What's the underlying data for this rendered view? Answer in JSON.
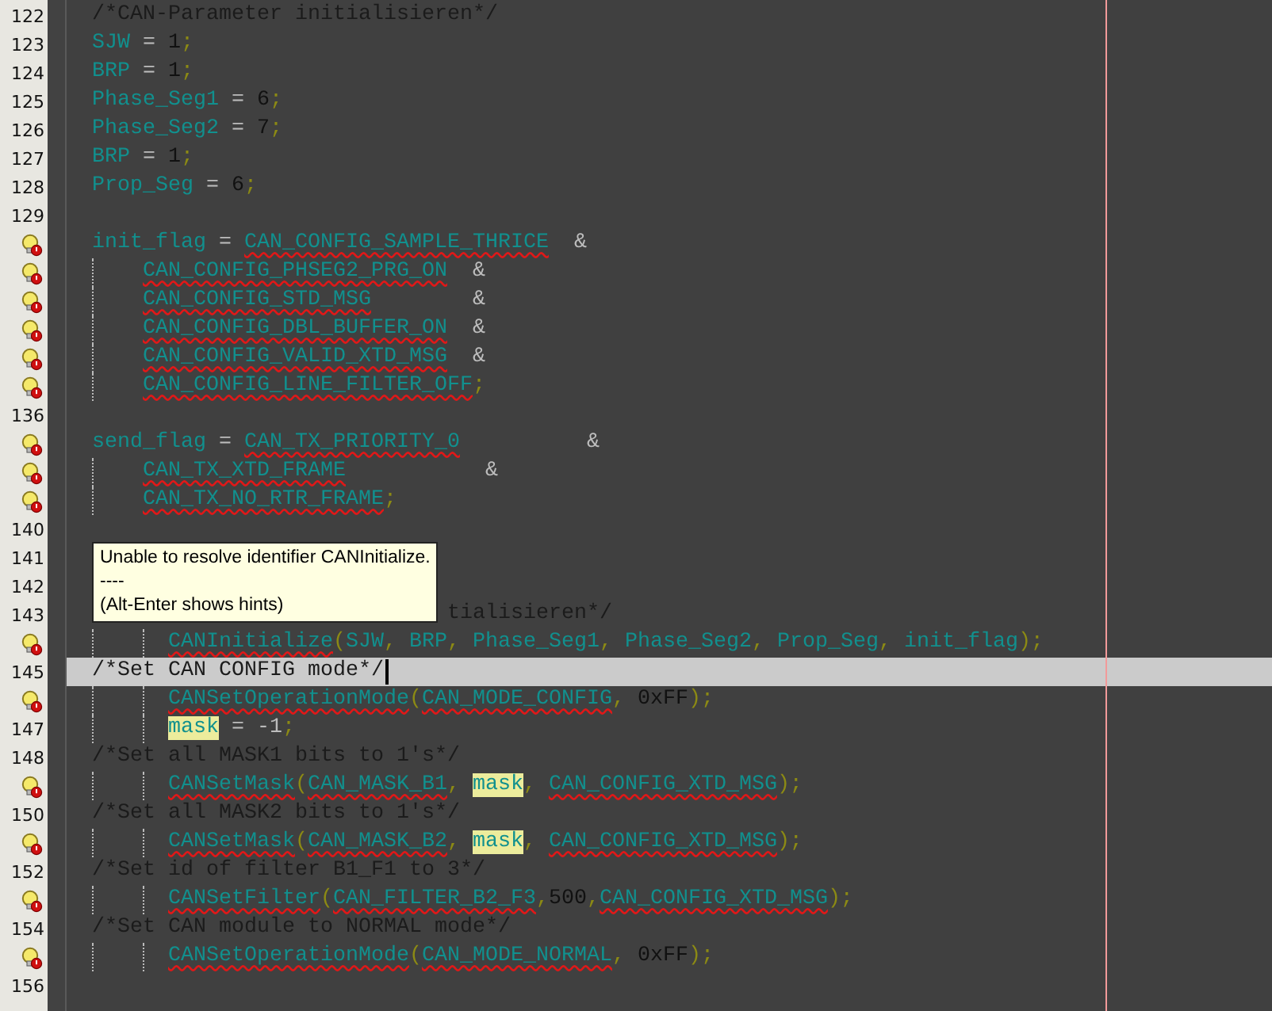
{
  "editor": {
    "lines": [
      {
        "number": "122",
        "kind": "plain",
        "current": false,
        "tokens": [
          {
            "kind": "comment",
            "text": "/*CAN-Parameter initialisieren*/"
          }
        ]
      },
      {
        "number": "123",
        "kind": "plain",
        "current": false,
        "tokens": [
          {
            "kind": "ident",
            "text": "SJW"
          },
          {
            "kind": "op",
            "text": " = "
          },
          {
            "kind": "number",
            "text": "1"
          },
          {
            "kind": "punct",
            "text": ";"
          }
        ]
      },
      {
        "number": "124",
        "kind": "plain",
        "current": false,
        "tokens": [
          {
            "kind": "ident",
            "text": "BRP"
          },
          {
            "kind": "op",
            "text": " = "
          },
          {
            "kind": "number",
            "text": "1"
          },
          {
            "kind": "punct",
            "text": ";"
          }
        ]
      },
      {
        "number": "125",
        "kind": "plain",
        "current": false,
        "tokens": [
          {
            "kind": "ident",
            "text": "Phase_Seg1"
          },
          {
            "kind": "op",
            "text": " = "
          },
          {
            "kind": "number",
            "text": "6"
          },
          {
            "kind": "punct",
            "text": ";"
          }
        ]
      },
      {
        "number": "126",
        "kind": "plain",
        "current": false,
        "tokens": [
          {
            "kind": "ident",
            "text": "Phase_Seg2"
          },
          {
            "kind": "op",
            "text": " = "
          },
          {
            "kind": "number",
            "text": "7"
          },
          {
            "kind": "punct",
            "text": ";"
          }
        ]
      },
      {
        "number": "127",
        "kind": "plain",
        "current": false,
        "tokens": [
          {
            "kind": "ident",
            "text": "BRP"
          },
          {
            "kind": "op",
            "text": " = "
          },
          {
            "kind": "number",
            "text": "1"
          },
          {
            "kind": "punct",
            "text": ";"
          }
        ]
      },
      {
        "number": "128",
        "kind": "plain",
        "current": false,
        "tokens": [
          {
            "kind": "ident",
            "text": "Prop_Seg"
          },
          {
            "kind": "op",
            "text": " = "
          },
          {
            "kind": "number",
            "text": "6"
          },
          {
            "kind": "punct",
            "text": ";"
          }
        ]
      },
      {
        "number": "129",
        "kind": "plain",
        "current": false
      },
      {
        "marker": {
          "kind": "error-hint"
        },
        "kind": "plain",
        "current": false,
        "tokens": [
          {
            "kind": "ident",
            "text": "init_flag"
          },
          {
            "kind": "op",
            "text": " = "
          },
          {
            "kind": "error",
            "text": "CAN_CONFIG_SAMPLE_THRICE"
          },
          {
            "kind": "op",
            "text": "  &"
          }
        ]
      },
      {
        "marker": {
          "kind": "error-hint"
        },
        "kind": "continued",
        "current": false,
        "tokens": [
          {
            "kind": "error",
            "text": "CAN_CONFIG_PHSEG2_PRG_ON"
          },
          {
            "kind": "op",
            "text": "  &"
          }
        ]
      },
      {
        "marker": {
          "kind": "error-hint"
        },
        "kind": "continued",
        "current": false,
        "tokens": [
          {
            "kind": "error",
            "text": "CAN_CONFIG_STD_MSG"
          },
          {
            "kind": "op",
            "text": "        &"
          }
        ]
      },
      {
        "marker": {
          "kind": "error-hint"
        },
        "kind": "continued",
        "current": false,
        "tokens": [
          {
            "kind": "error",
            "text": "CAN_CONFIG_DBL_BUFFER_ON"
          },
          {
            "kind": "op",
            "text": "  &"
          }
        ]
      },
      {
        "marker": {
          "kind": "error-hint"
        },
        "kind": "continued",
        "current": false,
        "tokens": [
          {
            "kind": "error",
            "text": "CAN_CONFIG_VALID_XTD_MSG"
          },
          {
            "kind": "op",
            "text": "  &"
          }
        ]
      },
      {
        "marker": {
          "kind": "error-hint"
        },
        "kind": "continued",
        "current": false,
        "tokens": [
          {
            "kind": "error",
            "text": "CAN_CONFIG_LINE_FILTER_OFF"
          },
          {
            "kind": "punct",
            "text": ";"
          }
        ]
      },
      {
        "number": "136",
        "kind": "plain",
        "current": false
      },
      {
        "marker": {
          "kind": "error-hint"
        },
        "kind": "plain",
        "current": false,
        "tokens": [
          {
            "kind": "ident",
            "text": "send_flag"
          },
          {
            "kind": "op",
            "text": " = "
          },
          {
            "kind": "error",
            "text": "CAN_TX_PRIORITY_0"
          },
          {
            "kind": "op",
            "text": "          &"
          }
        ]
      },
      {
        "marker": {
          "kind": "error-hint"
        },
        "kind": "continued",
        "current": false,
        "tokens": [
          {
            "kind": "error",
            "text": "CAN_TX_XTD_FRAME"
          },
          {
            "kind": "op",
            "text": "           &"
          }
        ]
      },
      {
        "marker": {
          "kind": "error-hint"
        },
        "kind": "continued",
        "current": false,
        "tokens": [
          {
            "kind": "error",
            "text": "CAN_TX_NO_RTR_FRAME"
          },
          {
            "kind": "punct",
            "text": ";"
          }
        ]
      },
      {
        "number": "140",
        "kind": "plain",
        "current": false
      },
      {
        "number": "141",
        "kind": "plain",
        "current": false
      },
      {
        "number": "142",
        "kind": "plain",
        "current": false
      },
      {
        "number": "143",
        "kind": "partly-covered",
        "current": false,
        "tokens": [
          {
            "kind": "comment",
            "text": "tialisieren*/"
          }
        ]
      },
      {
        "marker": {
          "kind": "error-hint"
        },
        "kind": "body",
        "current": false,
        "tokens": [
          {
            "kind": "error",
            "text": "CANInitialize"
          },
          {
            "kind": "punct",
            "text": "("
          },
          {
            "kind": "ident",
            "text": "SJW"
          },
          {
            "kind": "punct",
            "text": ", "
          },
          {
            "kind": "ident",
            "text": "BRP"
          },
          {
            "kind": "punct",
            "text": ", "
          },
          {
            "kind": "ident",
            "text": "Phase_Seg1"
          },
          {
            "kind": "punct",
            "text": ", "
          },
          {
            "kind": "ident",
            "text": "Phase_Seg2"
          },
          {
            "kind": "punct",
            "text": ", "
          },
          {
            "kind": "ident",
            "text": "Prop_Seg"
          },
          {
            "kind": "punct",
            "text": ", "
          },
          {
            "kind": "ident",
            "text": "init_flag"
          },
          {
            "kind": "punct",
            "text": ");"
          }
        ]
      },
      {
        "number": "145",
        "kind": "plain",
        "current": true,
        "tokens": [
          {
            "kind": "comment",
            "text": "/*Set CAN CONFIG mode*/"
          }
        ]
      },
      {
        "marker": {
          "kind": "error-hint"
        },
        "kind": "body",
        "current": false,
        "tokens": [
          {
            "kind": "error",
            "text": "CANSetOperationMode"
          },
          {
            "kind": "punct",
            "text": "("
          },
          {
            "kind": "error",
            "text": "CAN_MODE_CONFIG"
          },
          {
            "kind": "punct",
            "text": ", "
          },
          {
            "kind": "number",
            "text": "0xFF"
          },
          {
            "kind": "punct",
            "text": ");"
          }
        ]
      },
      {
        "number": "147",
        "kind": "body",
        "current": false,
        "tokens": [
          {
            "kind": "marked",
            "text": "mask"
          },
          {
            "kind": "op",
            "text": " = -1"
          },
          {
            "kind": "punct",
            "text": ";"
          }
        ]
      },
      {
        "number": "148",
        "kind": "plain",
        "current": false,
        "tokens": [
          {
            "kind": "comment",
            "text": "/*Set all MASK1 bits to 1's*/"
          }
        ]
      },
      {
        "marker": {
          "kind": "error-hint"
        },
        "kind": "body",
        "current": false,
        "tokens": [
          {
            "kind": "error",
            "text": "CANSetMask"
          },
          {
            "kind": "punct",
            "text": "("
          },
          {
            "kind": "error",
            "text": "CAN_MASK_B1"
          },
          {
            "kind": "punct",
            "text": ", "
          },
          {
            "kind": "marked",
            "text": "mask"
          },
          {
            "kind": "punct",
            "text": ", "
          },
          {
            "kind": "error",
            "text": "CAN_CONFIG_XTD_MSG"
          },
          {
            "kind": "punct",
            "text": ");"
          }
        ]
      },
      {
        "number": "150",
        "kind": "plain",
        "current": false,
        "tokens": [
          {
            "kind": "comment",
            "text": "/*Set all MASK2 bits to 1's*/"
          }
        ]
      },
      {
        "marker": {
          "kind": "error-hint"
        },
        "kind": "body",
        "current": false,
        "tokens": [
          {
            "kind": "error",
            "text": "CANSetMask"
          },
          {
            "kind": "punct",
            "text": "("
          },
          {
            "kind": "error",
            "text": "CAN_MASK_B2"
          },
          {
            "kind": "punct",
            "text": ", "
          },
          {
            "kind": "marked",
            "text": "mask"
          },
          {
            "kind": "punct",
            "text": ", "
          },
          {
            "kind": "error",
            "text": "CAN_CONFIG_XTD_MSG"
          },
          {
            "kind": "punct",
            "text": ");"
          }
        ]
      },
      {
        "number": "152",
        "kind": "plain",
        "current": false,
        "tokens": [
          {
            "kind": "comment",
            "text": "/*Set id of filter B1_F1 to 3*/"
          }
        ]
      },
      {
        "marker": {
          "kind": "error-hint"
        },
        "kind": "body",
        "current": false,
        "tokens": [
          {
            "kind": "error",
            "text": "CANSetFilter"
          },
          {
            "kind": "punct",
            "text": "("
          },
          {
            "kind": "error",
            "text": "CAN_FILTER_B2_F3"
          },
          {
            "kind": "punct",
            "text": ","
          },
          {
            "kind": "number",
            "text": "500"
          },
          {
            "kind": "punct",
            "text": ","
          },
          {
            "kind": "error",
            "text": "CAN_CONFIG_XTD_MSG"
          },
          {
            "kind": "punct",
            "text": ");"
          }
        ]
      },
      {
        "number": "154",
        "kind": "plain",
        "current": false,
        "tokens": [
          {
            "kind": "comment",
            "text": "/*Set CAN module to NORMAL mode*/"
          }
        ]
      },
      {
        "marker": {
          "kind": "error-hint"
        },
        "kind": "body",
        "current": false,
        "tokens": [
          {
            "kind": "error",
            "text": "CANSetOperationMode"
          },
          {
            "kind": "punct",
            "text": "("
          },
          {
            "kind": "error",
            "text": "CAN_MODE_NORMAL"
          },
          {
            "kind": "punct",
            "text": ", "
          },
          {
            "kind": "number",
            "text": "0xFF"
          },
          {
            "kind": "punct",
            "text": ");"
          }
        ]
      },
      {
        "number": "156",
        "kind": "plain",
        "current": false
      }
    ]
  },
  "tooltip": {
    "lines": [
      "Unable to resolve identifier CANInitialize.",
      "----",
      "(Alt-Enter shows hints)"
    ]
  }
}
